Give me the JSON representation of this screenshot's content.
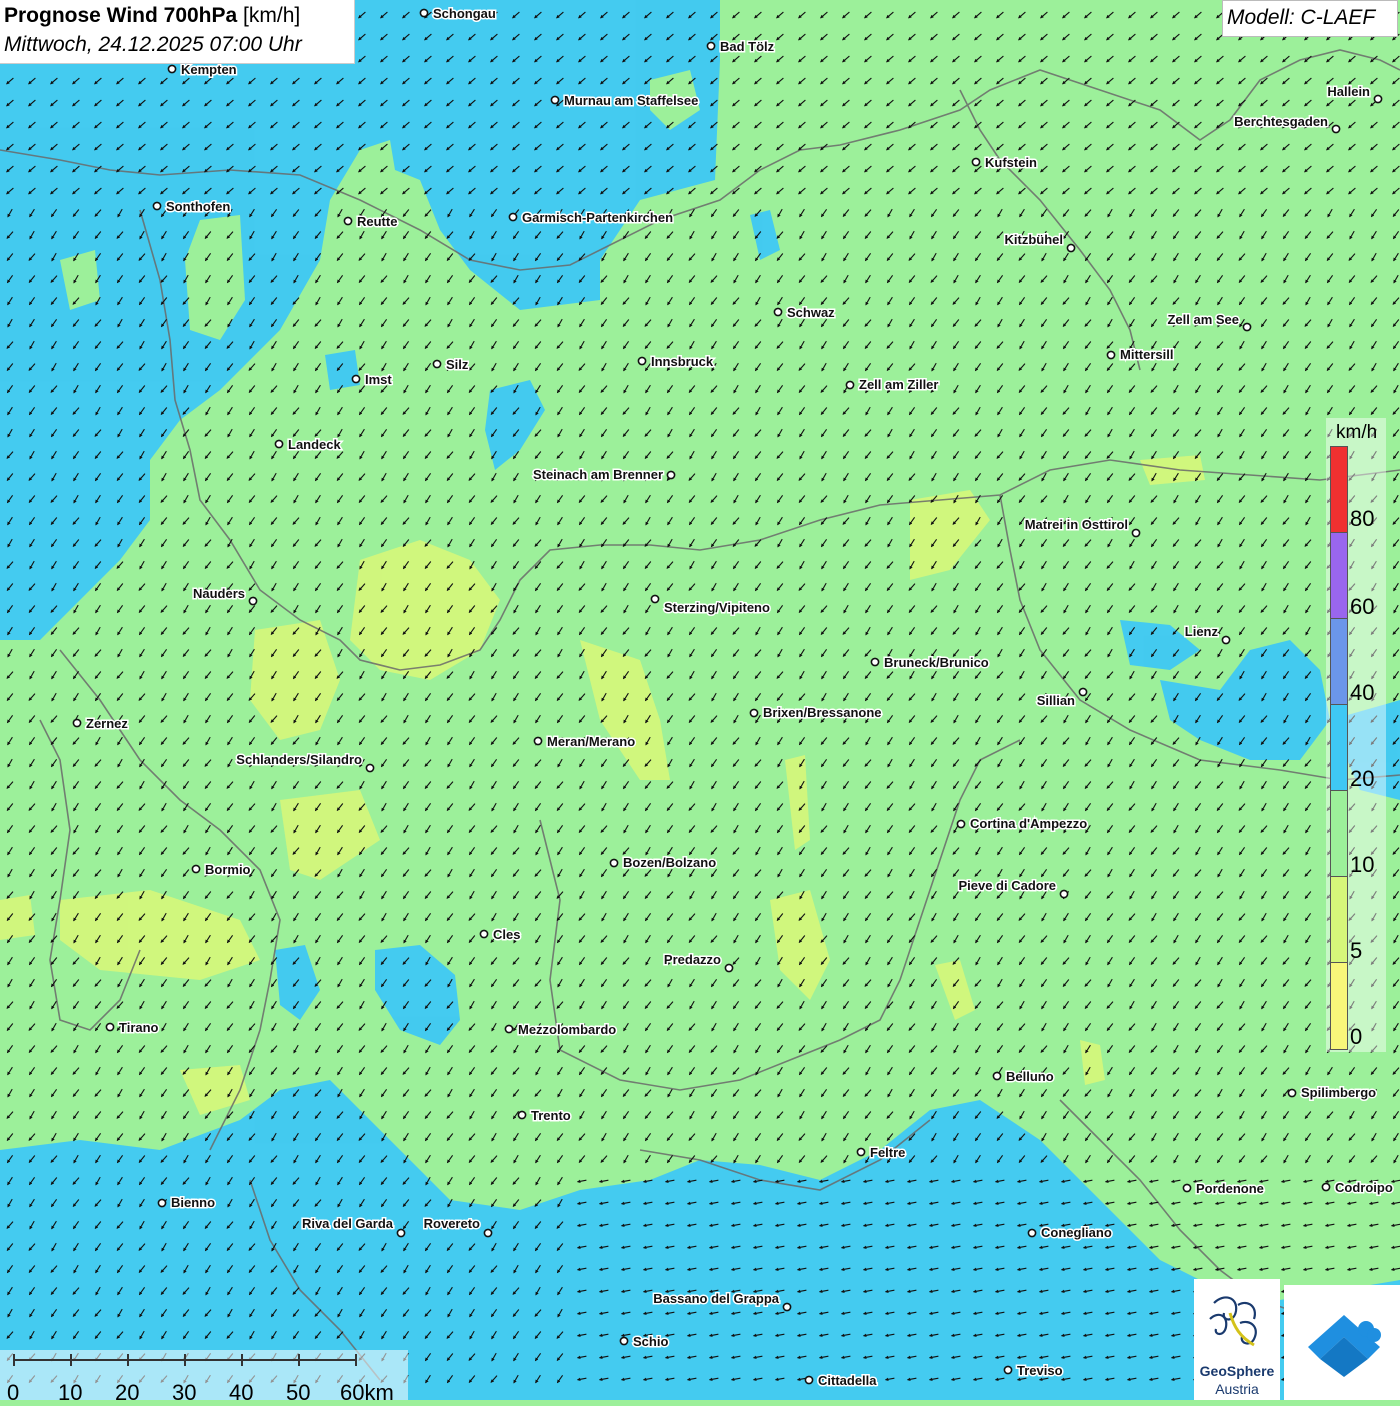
{
  "title": {
    "main": "Prognose Wind 700hPa",
    "unit": "[km/h]",
    "datetime": "Mittwoch, 24.12.2025 07:00 Uhr"
  },
  "model": {
    "label": "Modell: C-LAEF"
  },
  "legend": {
    "unit": "km/h",
    "ticks": [
      "80",
      "60",
      "40",
      "20",
      "10",
      "5",
      "0"
    ],
    "colors": {
      "80_plus": "#f03030",
      "60_80": "#9966ee",
      "40_60": "#6b96ea",
      "20_40": "#3fc8f4",
      "10_20": "#9cf09a",
      "5_10": "#d6f77a",
      "0_5": "#f8f77a"
    }
  },
  "scalebar": {
    "ticks": [
      "0",
      "10",
      "20",
      "30",
      "40",
      "50",
      "60km"
    ]
  },
  "logos": {
    "geosphere_name": "GeoSphere",
    "geosphere_country": "Austria",
    "app_icon": "weather-app-icon"
  },
  "cities": [
    "Schongau",
    "Bad Tölz",
    "Kempten",
    "Murnau am Staffelsee",
    "Hallein",
    "Berchtesgaden",
    "Kufstein",
    "Sonthofen",
    "Reutte",
    "Garmisch-Partenkirchen",
    "Kitzbühel",
    "Schwaz",
    "Zell am See",
    "Mittersill",
    "Imst",
    "Silz",
    "Innsbruck",
    "Zell am Ziller",
    "Landeck",
    "Steinach am Brenner",
    "Matrei in Osttirol",
    "Nauders",
    "Sterzing/Vipiteno",
    "Lienz",
    "Bruneck/Brunico",
    "Sillian",
    "Brixen/Bressanone",
    "Zernez",
    "Meran/Merano",
    "Schlanders/Silandro",
    "Cortina d'Ampezzo",
    "Bozen/Bolzano",
    "Bormio",
    "Pieve di Cadore",
    "Cles",
    "Predazzo",
    "Tirano",
    "Mezzolombardo",
    "Belluno",
    "Spilimbergo",
    "Trento",
    "Feltre",
    "Pordenone",
    "Codroipo",
    "Bienno",
    "Riva del Garda",
    "Rovereto",
    "Conegliano",
    "Bassano del Grappa",
    "Schio",
    "Treviso",
    "Cittadella"
  ]
}
